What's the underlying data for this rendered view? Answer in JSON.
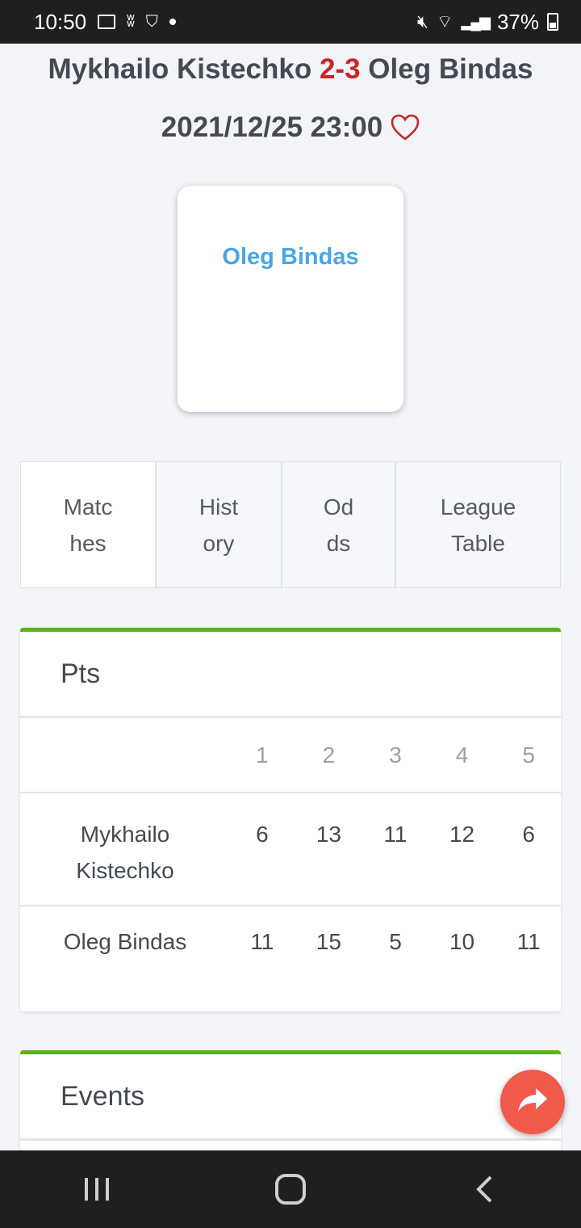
{
  "status_bar": {
    "time": "10:50",
    "battery": "37%"
  },
  "match": {
    "home_player": "Mykhailo Kistechko",
    "score": "2-3",
    "away_player": "Oleg Bindas",
    "datetime": "2021/12/25 23:00"
  },
  "winner_card": {
    "name": "Oleg Bindas"
  },
  "tabs": [
    {
      "label": "Matc\nhes"
    },
    {
      "label": "Hist\nory"
    },
    {
      "label": "Od\nds"
    },
    {
      "label": "League\nTable"
    }
  ],
  "pts_panel": {
    "title": "Pts",
    "sets": [
      "1",
      "2",
      "3",
      "4",
      "5"
    ],
    "rows": [
      {
        "player": "Mykhailo Kistechko",
        "points": [
          "6",
          "13",
          "11",
          "12",
          "6"
        ]
      },
      {
        "player": "Oleg Bindas",
        "points": [
          "11",
          "15",
          "5",
          "10",
          "11"
        ]
      }
    ]
  },
  "events_panel": {
    "title": "Events"
  },
  "colors": {
    "score": "#c62828",
    "winner_name": "#48a6e6",
    "panel_accent": "#5bb318",
    "fab": "#f05a4a"
  }
}
